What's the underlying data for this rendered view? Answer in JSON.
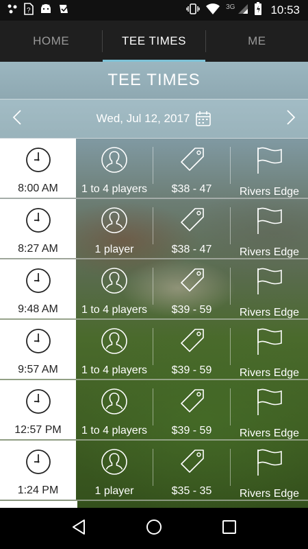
{
  "status_bar": {
    "network": "3G",
    "time": "10:53"
  },
  "tabs": [
    {
      "label": "HOME",
      "active": false
    },
    {
      "label": "TEE TIMES",
      "active": true
    },
    {
      "label": "ME",
      "active": false
    }
  ],
  "page": {
    "title": "TEE TIMES",
    "date": "Wed, Jul 12, 2017"
  },
  "tee_times": [
    {
      "time": "8:00 AM",
      "players": "1 to 4 players",
      "price": "$38 - 47",
      "course": "Rivers Edge"
    },
    {
      "time": "8:27 AM",
      "players": "1 player",
      "price": "$38 - 47",
      "course": "Rivers Edge"
    },
    {
      "time": "9:48 AM",
      "players": "1 to 4 players",
      "price": "$39 - 59",
      "course": "Rivers Edge"
    },
    {
      "time": "9:57 AM",
      "players": "1 to 4 players",
      "price": "$39 - 59",
      "course": "Rivers Edge"
    },
    {
      "time": "12:57 PM",
      "players": "1 to 4 players",
      "price": "$39 - 59",
      "course": "Rivers Edge"
    },
    {
      "time": "1:24 PM",
      "players": "1 player",
      "price": "$35 - 35",
      "course": "Rivers Edge"
    }
  ],
  "colors": {
    "tab_indicator": "#7ec3d8",
    "tab_bar": "#1f1f1f",
    "status_bar": "#111111"
  },
  "icons": {
    "row": [
      "clock-icon",
      "user-icon",
      "price-tag-icon",
      "flag-icon"
    ],
    "date_bar": [
      "chevron-left-icon",
      "calendar-icon",
      "chevron-right-icon"
    ],
    "nav": [
      "back-icon",
      "home-icon",
      "recents-icon"
    ]
  }
}
